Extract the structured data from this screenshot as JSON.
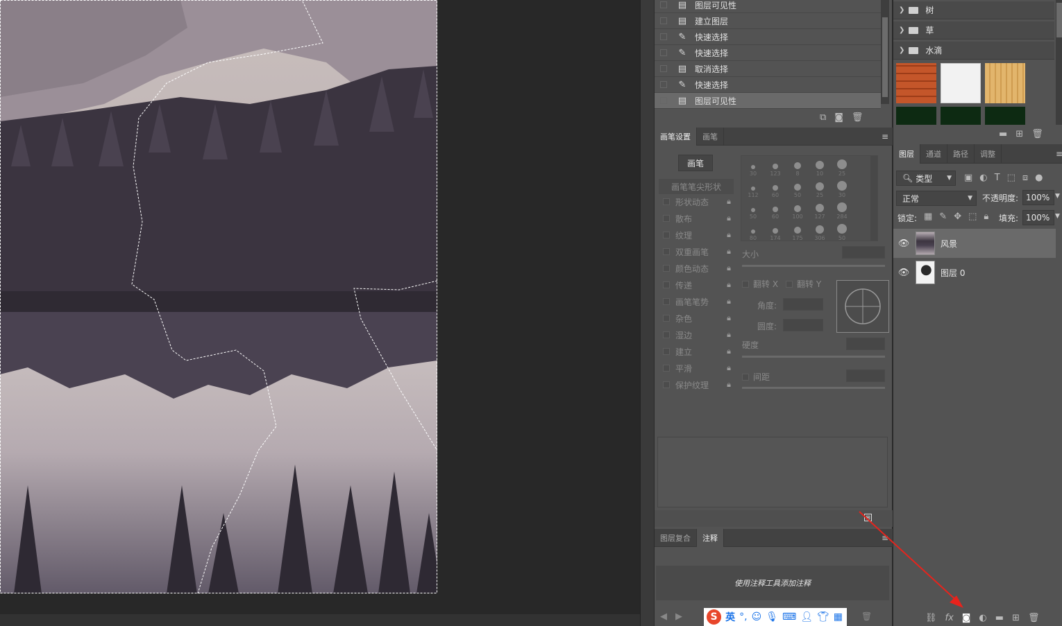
{
  "history": {
    "items": [
      {
        "label": "图层可见性",
        "icon": "document-icon"
      },
      {
        "label": "建立图层",
        "icon": "document-icon"
      },
      {
        "label": "快速选择",
        "icon": "quick-select-icon"
      },
      {
        "label": "快速选择",
        "icon": "quick-select-icon"
      },
      {
        "label": "取消选择",
        "icon": "document-icon"
      },
      {
        "label": "快速选择",
        "icon": "quick-select-icon"
      },
      {
        "label": "图层可见性",
        "icon": "document-icon"
      }
    ],
    "selected_index": 6
  },
  "brush_panel": {
    "tabs": [
      "画笔设置",
      "画笔"
    ],
    "brush_button": "画笔",
    "tip_shape": "画笔笔尖形状",
    "options": [
      "形状动态",
      "散布",
      "纹理",
      "双重画笔",
      "颜色动态",
      "传递",
      "画笔笔势",
      "杂色",
      "湿边",
      "建立",
      "平滑",
      "保护纹理"
    ],
    "sizes": [
      "30",
      "123",
      "8",
      "10",
      "25",
      "112",
      "60",
      "50",
      "25",
      "30",
      "50",
      "60",
      "100",
      "127",
      "284",
      "80",
      "174",
      "175",
      "306",
      "50"
    ],
    "size_label": "大小",
    "flip_x": "翻转 X",
    "flip_y": "翻转 Y",
    "angle_label": "角度:",
    "roundness_label": "圆度:",
    "hardness_label": "硬度",
    "spacing_label": "间距"
  },
  "notes_panel": {
    "tabs": [
      "图层复合",
      "注释"
    ],
    "placeholder": "使用注释工具添加注释"
  },
  "library": {
    "folders": [
      "树",
      "草",
      "水滴"
    ]
  },
  "layers_panel": {
    "tabs": [
      "图层",
      "通道",
      "路径",
      "调整"
    ],
    "filter_kind": "类型",
    "blend_mode": "正常",
    "opacity_label": "不透明度:",
    "opacity_value": "100%",
    "lock_label": "锁定:",
    "fill_label": "填充:",
    "fill_value": "100%",
    "layers": [
      {
        "name": "风景",
        "selected": true
      },
      {
        "name": "图层 0",
        "selected": false
      }
    ]
  },
  "ime_toolbar": {
    "mode": "英"
  }
}
